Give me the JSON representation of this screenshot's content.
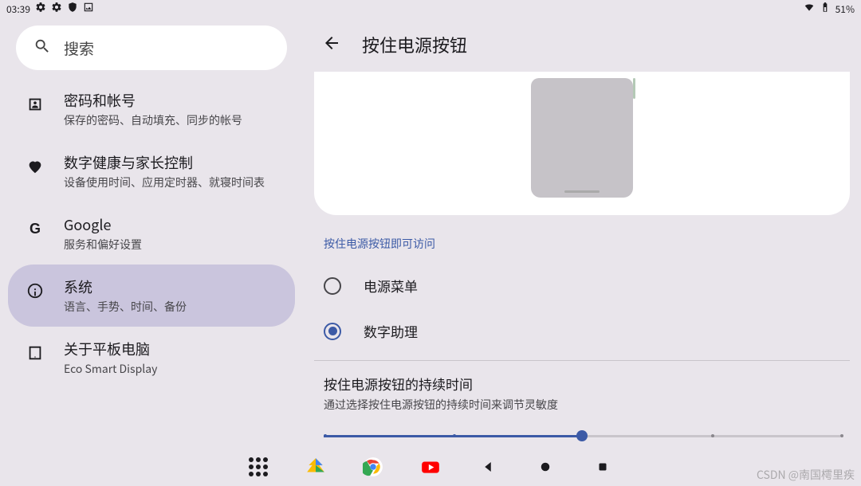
{
  "status": {
    "time": "03:39",
    "battery": "51%"
  },
  "search": {
    "placeholder": "搜索"
  },
  "sidebar": {
    "items": [
      {
        "icon": "user-badge",
        "title": "密码和帐号",
        "sub": "保存的密码、自动填充、同步的帐号"
      },
      {
        "icon": "heart",
        "title": "数字健康与家长控制",
        "sub": "设备使用时间、应用定时器、就寝时间表"
      },
      {
        "icon": "google",
        "title": "Google",
        "sub": "服务和偏好设置"
      },
      {
        "icon": "info",
        "title": "系统",
        "sub": "语言、手势、时间、备份",
        "selected": true
      },
      {
        "icon": "tablet",
        "title": "关于平板电脑",
        "sub": "Eco Smart Display"
      }
    ]
  },
  "content": {
    "header": "按住电源按钮",
    "section_label": "按住电源按钮即可访问",
    "options": [
      {
        "label": "电源菜单",
        "checked": false
      },
      {
        "label": "数字助理",
        "checked": true
      }
    ],
    "slider": {
      "title": "按住电源按钮的持续时间",
      "sub": "通过选择按住电源按钮的持续时间来调节灵敏度",
      "value": 2,
      "max": 4
    }
  },
  "watermark": "CSDN @南国樗里疾"
}
